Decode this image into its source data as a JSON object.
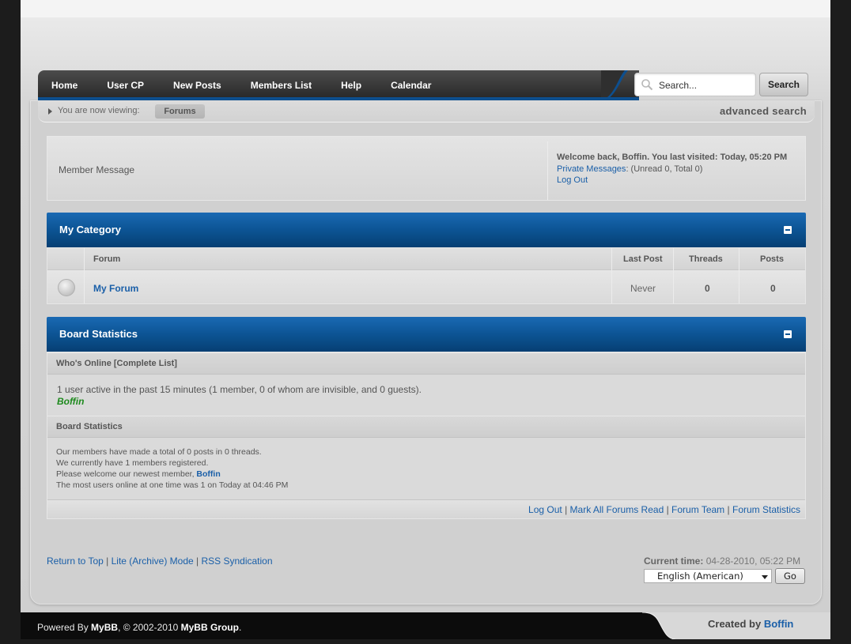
{
  "nav": {
    "items": [
      {
        "label": "Home"
      },
      {
        "label": "User CP"
      },
      {
        "label": "New Posts"
      },
      {
        "label": "Members List"
      },
      {
        "label": "Help"
      },
      {
        "label": "Calendar"
      }
    ]
  },
  "search": {
    "placeholder": "Search...",
    "button_label": "Search",
    "advanced_label": "advanced search"
  },
  "breadcrumb": {
    "label": "You are now viewing:",
    "current": "Forums"
  },
  "member_box": {
    "message": "Member Message",
    "welcome": "Welcome back, Boffin. You last visited: Today, 05:20 PM",
    "pm_link": "Private Messages",
    "pm_counts": ": (Unread 0, Total 0)",
    "logout": "Log Out"
  },
  "category": {
    "title": "My Category",
    "columns": {
      "forum": "Forum",
      "last_post": "Last Post",
      "threads": "Threads",
      "posts": "Posts"
    },
    "forums": [
      {
        "name": "My Forum",
        "last_post": "Never",
        "threads": "0",
        "posts": "0"
      }
    ]
  },
  "board_stats": {
    "title": "Board Statistics",
    "whos_online_head": "Who's Online [Complete List]",
    "online_text": "1 user active in the past 15 minutes (1 member, 0 of whom are invisible, and 0 guests).",
    "online_user": "Boffin",
    "stats_head": "Board Statistics",
    "line1": "Our members have made a total of 0 posts in 0 threads.",
    "line2": "We currently have 1 members registered.",
    "line3_prefix": "Please welcome our newest member,",
    "newest_member": "Boffin",
    "line4": "The most users online at one time was 1 on Today at 04:46 PM",
    "links": [
      "Log Out",
      "Mark All Forums Read",
      "Forum Team",
      "Forum Statistics"
    ]
  },
  "footer": {
    "links": [
      "Return to Top",
      "Lite (Archive) Mode",
      "RSS Syndication"
    ],
    "current_time_label": "Current time:",
    "current_time": "04-28-2010, 05:22 PM",
    "language": "English (American)",
    "go_label": "Go",
    "powered_prefix": "Powered By",
    "powered_mybb": "MyBB",
    "powered_mid": ", © 2002-2010",
    "powered_group": "MyBB Group",
    "powered_end": ".",
    "created_by": "Created by",
    "created_name": "Boffin"
  },
  "colors": {
    "accent": "#0c5494",
    "link": "#1a5fa8",
    "online_user": "#1e8a1e"
  }
}
